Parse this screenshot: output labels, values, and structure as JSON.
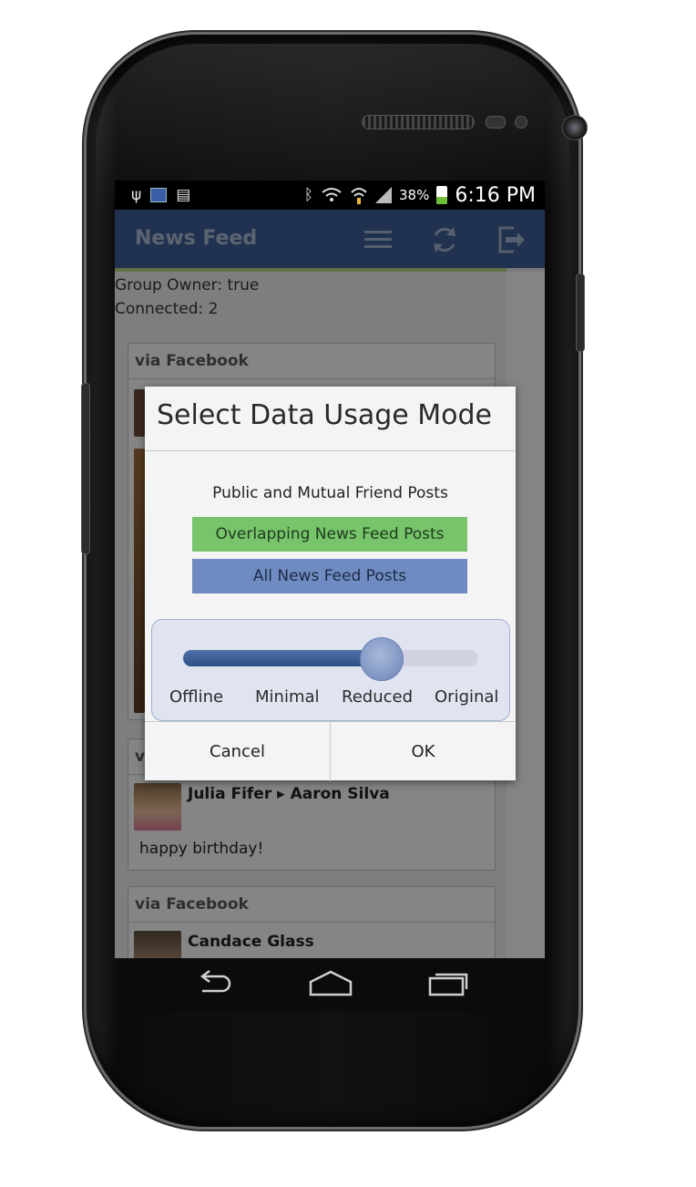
{
  "status_bar": {
    "battery_percent": "38%",
    "time": "6:16 PM",
    "icons": [
      "usb-icon",
      "image-icon",
      "file-icon",
      "bluetooth-icon",
      "wifi-icon",
      "signal-icon",
      "battery-icon"
    ]
  },
  "app_bar": {
    "title": "News Feed",
    "actions": [
      "menu-icon",
      "refresh-icon",
      "logout-icon"
    ]
  },
  "feed": {
    "group_owner": "Group Owner: true",
    "connected": "Connected: 2",
    "cards": [
      {
        "source": "via Facebook"
      },
      {
        "source_partial": "vi",
        "author": "Julia Fifer ▸ Aaron Silva",
        "text": "happy birthday!"
      },
      {
        "source": "via Facebook",
        "author": "Candace Glass"
      }
    ]
  },
  "dialog": {
    "title": "Select Data Usage Mode",
    "caption": "Public and Mutual Friend Posts",
    "chip_overlapping": "Overlapping News Feed Posts",
    "chip_all": "All News Feed Posts",
    "slider": {
      "options": [
        "Offline",
        "Minimal",
        "Reduced",
        "Original"
      ],
      "selected": "Reduced",
      "level_percent": 67
    },
    "cancel_label": "Cancel",
    "ok_label": "OK"
  },
  "colors": {
    "app_bar": "#3b5b92",
    "chip_green": "#77c46a",
    "chip_blue": "#6f8bc1",
    "accent_line": "#8cbf3f"
  },
  "nav": [
    "back-icon",
    "home-icon",
    "recent-apps-icon"
  ]
}
